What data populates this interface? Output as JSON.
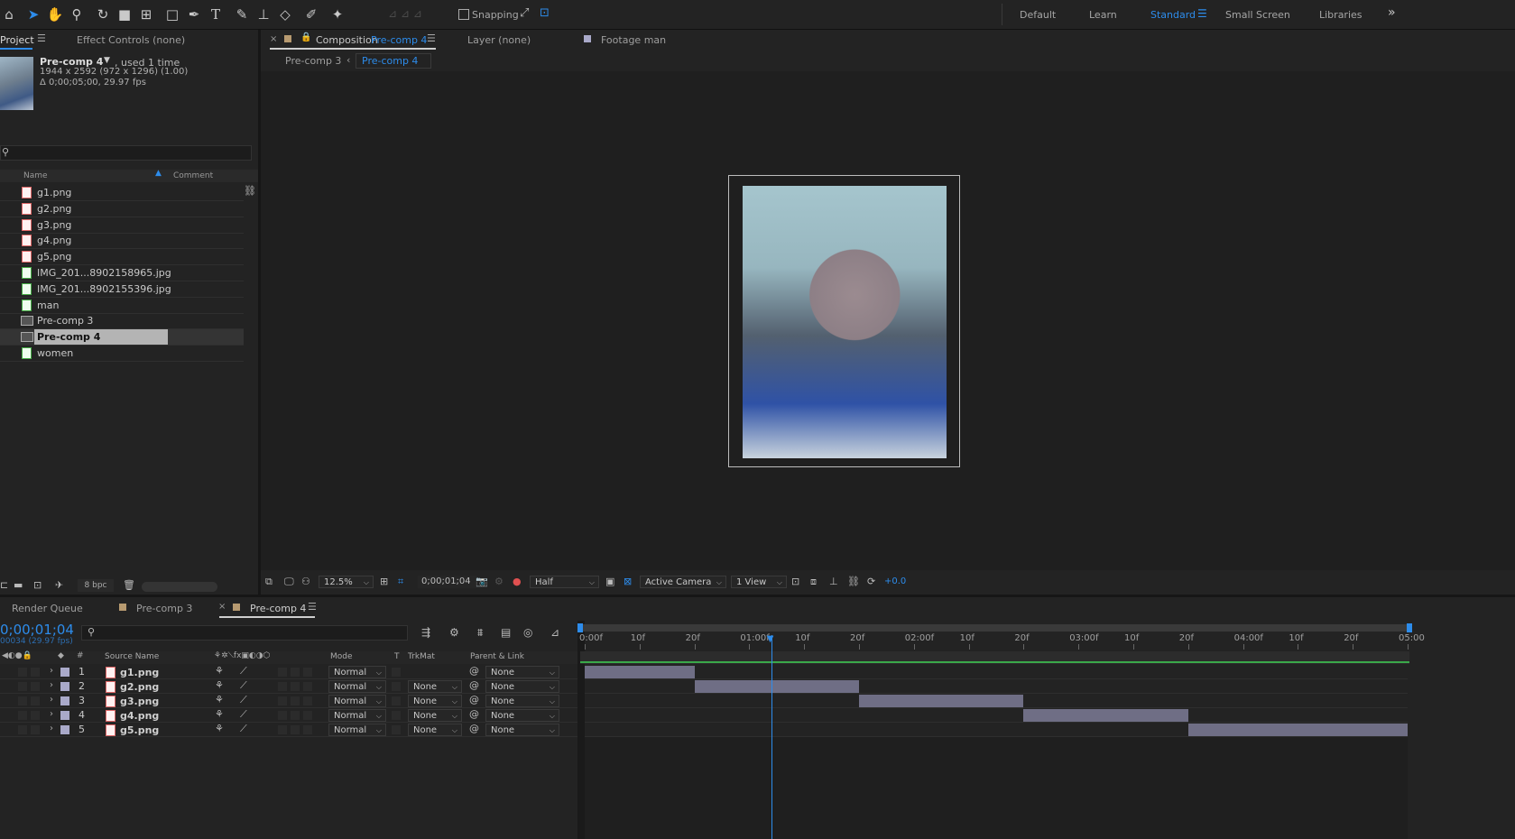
{
  "toolbar": {
    "snapping_label": "Snapping",
    "workspaces": [
      "Default",
      "Learn",
      "Standard",
      "Small Screen",
      "Libraries"
    ],
    "active_workspace": "Standard",
    "more": "»"
  },
  "project_panel": {
    "tab_project": "Project",
    "tab_effect_controls": "Effect Controls (none)",
    "selected_name": "Pre-comp 4",
    "used": ", used 1 time",
    "dims": "1944 x 2592  (972 x 1296) (1.00)",
    "duration": "Δ 0;00;05;00, 29.97 fps",
    "col_name": "Name",
    "col_comment": "Comment",
    "items": [
      {
        "name": "g1.png",
        "kind": "png"
      },
      {
        "name": "g2.png",
        "kind": "png"
      },
      {
        "name": "g3.png",
        "kind": "png"
      },
      {
        "name": "g4.png",
        "kind": "png"
      },
      {
        "name": "g5.png",
        "kind": "png"
      },
      {
        "name": "IMG_201...8902158965.jpg",
        "kind": "jpg"
      },
      {
        "name": "IMG_201...8902155396.jpg",
        "kind": "jpg"
      },
      {
        "name": "man",
        "kind": "jpg"
      },
      {
        "name": "Pre-comp 3",
        "kind": "comp"
      },
      {
        "name": "Pre-comp 4",
        "kind": "comp"
      },
      {
        "name": "women",
        "kind": "jpg"
      }
    ],
    "bpc": "8 bpc"
  },
  "comp_panel": {
    "tab_comp_prefix": "Composition",
    "tab_comp_name": "Pre-comp 4",
    "tab_layer": "Layer (none)",
    "tab_footage": "Footage man",
    "breadcrumb_1": "Pre-comp 3",
    "breadcrumb_2": "Pre-comp 4",
    "zoom": "12.5%",
    "timecode": "0;00;01;04",
    "resolution": "Half",
    "camera": "Active Camera",
    "views": "1 View",
    "exposure": "+0.0"
  },
  "timeline": {
    "tab_render_queue": "Render Queue",
    "tab_precomp3": "Pre-comp 3",
    "tab_precomp4": "Pre-comp 4",
    "current_time": "0;00;01;04",
    "frame_info": "00034 (29.97 fps)",
    "col_source_name": "Source Name",
    "col_mode": "Mode",
    "col_t": "T",
    "col_trkmat": "TrkMat",
    "col_parent": "Parent & Link",
    "ruler_labels": [
      "0:00f",
      "10f",
      "20f",
      "01:00f",
      "10f",
      "20f",
      "02:00f",
      "10f",
      "20f",
      "03:00f",
      "10f",
      "20f",
      "04:00f",
      "10f",
      "20f",
      "05:00"
    ],
    "layers": [
      {
        "num": "1",
        "name": "g1.png",
        "mode": "Normal",
        "trkmat": "",
        "parent": "None",
        "start": 0.0,
        "end": 0.6667
      },
      {
        "num": "2",
        "name": "g2.png",
        "mode": "Normal",
        "trkmat": "None",
        "parent": "None",
        "start": 0.6667,
        "end": 1.6667
      },
      {
        "num": "3",
        "name": "g3.png",
        "mode": "Normal",
        "trkmat": "None",
        "parent": "None",
        "start": 1.6667,
        "end": 2.6667
      },
      {
        "num": "4",
        "name": "g4.png",
        "mode": "Normal",
        "trkmat": "None",
        "parent": "None",
        "start": 2.6667,
        "end": 3.6667
      },
      {
        "num": "5",
        "name": "g5.png",
        "mode": "Normal",
        "trkmat": "None",
        "parent": "None",
        "start": 3.6667,
        "end": 5.0
      }
    ],
    "duration_s": 5.0,
    "playhead_s": 1.1335
  }
}
